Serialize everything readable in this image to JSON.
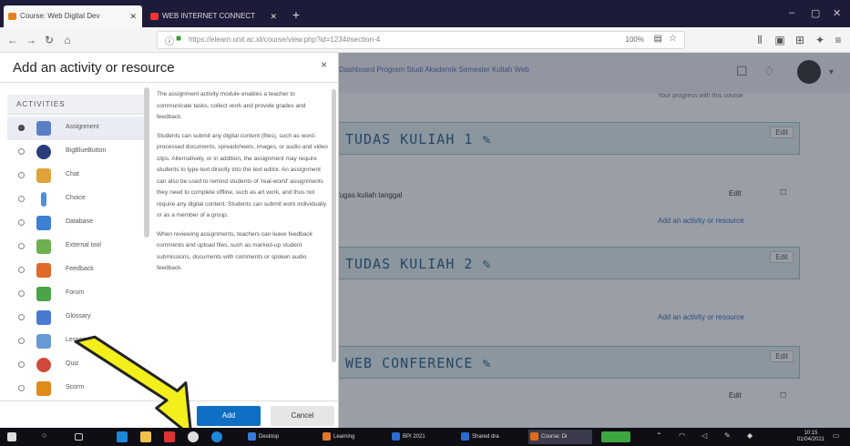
{
  "browser": {
    "tabs": [
      {
        "title": "Course: Web Digital Dev"
      },
      {
        "title": "WEB INTERNET CONNECT"
      }
    ],
    "url": "https://elearn.unit.ac.id/course/view.php?id=1234#section-4",
    "zoom": "100%"
  },
  "page": {
    "breadcrumb": "Dashboard  Program Studi  Akademik  Semester  Kuliah Web",
    "progress_note": "Your progress with this course",
    "sections": [
      {
        "title": "TUDAS KULIAH 1",
        "edit_label": "Edit"
      },
      {
        "title": "TUDAS KULIAH 2",
        "edit_label": "Edit"
      },
      {
        "title": "WEB CONFERENCE",
        "edit_label": "Edit"
      }
    ],
    "resource_line": "Tugas kuliah tanggal",
    "resource_edit": "Edit",
    "add_activity_link": "Add an activity or resource"
  },
  "modal": {
    "title": "Add an activity or resource",
    "close_symbol": "×",
    "activities_header": "ACTIVITIES",
    "activities": [
      {
        "label": "Assignment",
        "icon_color": "#5a7fc7",
        "selected": true
      },
      {
        "label": "BigBlueButton",
        "icon_color": "#2a3d7a",
        "selected": false
      },
      {
        "label": "Chat",
        "icon_color": "#e0a33a",
        "selected": false
      },
      {
        "label": "Choice",
        "icon_color": "#4f8fd6",
        "selected": false
      },
      {
        "label": "Database",
        "icon_color": "#3d7fd0",
        "selected": false
      },
      {
        "label": "External tool",
        "icon_color": "#6eb050",
        "selected": false
      },
      {
        "label": "Feedback",
        "icon_color": "#e06a2a",
        "selected": false
      },
      {
        "label": "Forum",
        "icon_color": "#4aa54a",
        "selected": false
      },
      {
        "label": "Glossary",
        "icon_color": "#4a7ad0",
        "selected": false
      },
      {
        "label": "Lesson",
        "icon_color": "#6a9ad6",
        "selected": false
      },
      {
        "label": "Quiz",
        "icon_color": "#d04a3a",
        "selected": false
      },
      {
        "label": "Scorm",
        "icon_color": "#e08a1a",
        "selected": false
      }
    ],
    "description": [
      "The assignment activity module enables a teacher to communicate tasks, collect work and provide grades and feedback.",
      "Students can submit any digital content (files), such as word-processed documents, spreadsheets, images, or audio and video clips. Alternatively, or in addition, the assignment may require students to type text directly into the text editor. An assignment can also be used to remind students of 'real-world' assignments they need to complete offline, such as art work, and thus not require any digital content. Students can submit work individually or as a member of a group.",
      "When reviewing assignments, teachers can leave feedback comments and upload files, such as marked-up student submissions, documents with comments or spoken audio feedback."
    ],
    "add_label": "Add",
    "cancel_label": "Cancel"
  },
  "taskbar": {
    "apps": [
      {
        "label": "Desktop",
        "color": "#3a78d8"
      },
      {
        "label": "Learning",
        "color": "#e07a2a"
      },
      {
        "label": "BPI 2021",
        "color": "#2b6cd0"
      },
      {
        "label": "Shared dra",
        "color": "#2b6cd0"
      },
      {
        "label": "Course: Di",
        "color": "#e06a1a"
      }
    ],
    "time": "10:15",
    "date": "01/04/2021"
  }
}
